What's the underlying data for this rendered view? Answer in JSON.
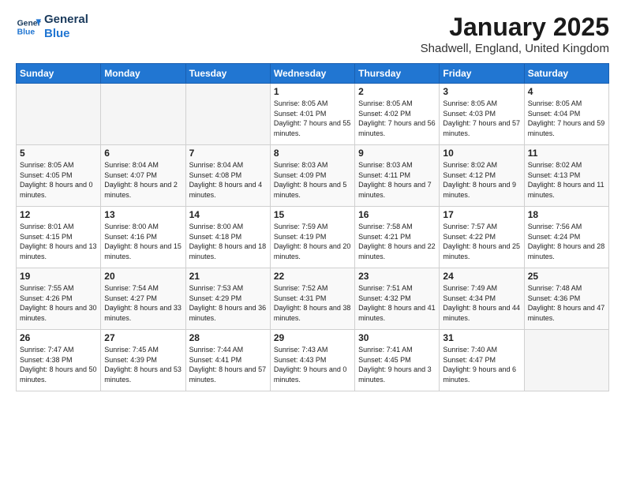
{
  "logo": {
    "line1": "General",
    "line2": "Blue"
  },
  "title": "January 2025",
  "subtitle": "Shadwell, England, United Kingdom",
  "days_of_week": [
    "Sunday",
    "Monday",
    "Tuesday",
    "Wednesday",
    "Thursday",
    "Friday",
    "Saturday"
  ],
  "weeks": [
    [
      {
        "day": "",
        "sunrise": "",
        "sunset": "",
        "daylight": "",
        "empty": true
      },
      {
        "day": "",
        "sunrise": "",
        "sunset": "",
        "daylight": "",
        "empty": true
      },
      {
        "day": "",
        "sunrise": "",
        "sunset": "",
        "daylight": "",
        "empty": true
      },
      {
        "day": "1",
        "sunrise": "Sunrise: 8:05 AM",
        "sunset": "Sunset: 4:01 PM",
        "daylight": "Daylight: 7 hours and 55 minutes."
      },
      {
        "day": "2",
        "sunrise": "Sunrise: 8:05 AM",
        "sunset": "Sunset: 4:02 PM",
        "daylight": "Daylight: 7 hours and 56 minutes."
      },
      {
        "day": "3",
        "sunrise": "Sunrise: 8:05 AM",
        "sunset": "Sunset: 4:03 PM",
        "daylight": "Daylight: 7 hours and 57 minutes."
      },
      {
        "day": "4",
        "sunrise": "Sunrise: 8:05 AM",
        "sunset": "Sunset: 4:04 PM",
        "daylight": "Daylight: 7 hours and 59 minutes."
      }
    ],
    [
      {
        "day": "5",
        "sunrise": "Sunrise: 8:05 AM",
        "sunset": "Sunset: 4:05 PM",
        "daylight": "Daylight: 8 hours and 0 minutes."
      },
      {
        "day": "6",
        "sunrise": "Sunrise: 8:04 AM",
        "sunset": "Sunset: 4:07 PM",
        "daylight": "Daylight: 8 hours and 2 minutes."
      },
      {
        "day": "7",
        "sunrise": "Sunrise: 8:04 AM",
        "sunset": "Sunset: 4:08 PM",
        "daylight": "Daylight: 8 hours and 4 minutes."
      },
      {
        "day": "8",
        "sunrise": "Sunrise: 8:03 AM",
        "sunset": "Sunset: 4:09 PM",
        "daylight": "Daylight: 8 hours and 5 minutes."
      },
      {
        "day": "9",
        "sunrise": "Sunrise: 8:03 AM",
        "sunset": "Sunset: 4:11 PM",
        "daylight": "Daylight: 8 hours and 7 minutes."
      },
      {
        "day": "10",
        "sunrise": "Sunrise: 8:02 AM",
        "sunset": "Sunset: 4:12 PM",
        "daylight": "Daylight: 8 hours and 9 minutes."
      },
      {
        "day": "11",
        "sunrise": "Sunrise: 8:02 AM",
        "sunset": "Sunset: 4:13 PM",
        "daylight": "Daylight: 8 hours and 11 minutes."
      }
    ],
    [
      {
        "day": "12",
        "sunrise": "Sunrise: 8:01 AM",
        "sunset": "Sunset: 4:15 PM",
        "daylight": "Daylight: 8 hours and 13 minutes."
      },
      {
        "day": "13",
        "sunrise": "Sunrise: 8:00 AM",
        "sunset": "Sunset: 4:16 PM",
        "daylight": "Daylight: 8 hours and 15 minutes."
      },
      {
        "day": "14",
        "sunrise": "Sunrise: 8:00 AM",
        "sunset": "Sunset: 4:18 PM",
        "daylight": "Daylight: 8 hours and 18 minutes."
      },
      {
        "day": "15",
        "sunrise": "Sunrise: 7:59 AM",
        "sunset": "Sunset: 4:19 PM",
        "daylight": "Daylight: 8 hours and 20 minutes."
      },
      {
        "day": "16",
        "sunrise": "Sunrise: 7:58 AM",
        "sunset": "Sunset: 4:21 PM",
        "daylight": "Daylight: 8 hours and 22 minutes."
      },
      {
        "day": "17",
        "sunrise": "Sunrise: 7:57 AM",
        "sunset": "Sunset: 4:22 PM",
        "daylight": "Daylight: 8 hours and 25 minutes."
      },
      {
        "day": "18",
        "sunrise": "Sunrise: 7:56 AM",
        "sunset": "Sunset: 4:24 PM",
        "daylight": "Daylight: 8 hours and 28 minutes."
      }
    ],
    [
      {
        "day": "19",
        "sunrise": "Sunrise: 7:55 AM",
        "sunset": "Sunset: 4:26 PM",
        "daylight": "Daylight: 8 hours and 30 minutes."
      },
      {
        "day": "20",
        "sunrise": "Sunrise: 7:54 AM",
        "sunset": "Sunset: 4:27 PM",
        "daylight": "Daylight: 8 hours and 33 minutes."
      },
      {
        "day": "21",
        "sunrise": "Sunrise: 7:53 AM",
        "sunset": "Sunset: 4:29 PM",
        "daylight": "Daylight: 8 hours and 36 minutes."
      },
      {
        "day": "22",
        "sunrise": "Sunrise: 7:52 AM",
        "sunset": "Sunset: 4:31 PM",
        "daylight": "Daylight: 8 hours and 38 minutes."
      },
      {
        "day": "23",
        "sunrise": "Sunrise: 7:51 AM",
        "sunset": "Sunset: 4:32 PM",
        "daylight": "Daylight: 8 hours and 41 minutes."
      },
      {
        "day": "24",
        "sunrise": "Sunrise: 7:49 AM",
        "sunset": "Sunset: 4:34 PM",
        "daylight": "Daylight: 8 hours and 44 minutes."
      },
      {
        "day": "25",
        "sunrise": "Sunrise: 7:48 AM",
        "sunset": "Sunset: 4:36 PM",
        "daylight": "Daylight: 8 hours and 47 minutes."
      }
    ],
    [
      {
        "day": "26",
        "sunrise": "Sunrise: 7:47 AM",
        "sunset": "Sunset: 4:38 PM",
        "daylight": "Daylight: 8 hours and 50 minutes."
      },
      {
        "day": "27",
        "sunrise": "Sunrise: 7:45 AM",
        "sunset": "Sunset: 4:39 PM",
        "daylight": "Daylight: 8 hours and 53 minutes."
      },
      {
        "day": "28",
        "sunrise": "Sunrise: 7:44 AM",
        "sunset": "Sunset: 4:41 PM",
        "daylight": "Daylight: 8 hours and 57 minutes."
      },
      {
        "day": "29",
        "sunrise": "Sunrise: 7:43 AM",
        "sunset": "Sunset: 4:43 PM",
        "daylight": "Daylight: 9 hours and 0 minutes."
      },
      {
        "day": "30",
        "sunrise": "Sunrise: 7:41 AM",
        "sunset": "Sunset: 4:45 PM",
        "daylight": "Daylight: 9 hours and 3 minutes."
      },
      {
        "day": "31",
        "sunrise": "Sunrise: 7:40 AM",
        "sunset": "Sunset: 4:47 PM",
        "daylight": "Daylight: 9 hours and 6 minutes."
      },
      {
        "day": "",
        "sunrise": "",
        "sunset": "",
        "daylight": "",
        "empty": true
      }
    ]
  ]
}
